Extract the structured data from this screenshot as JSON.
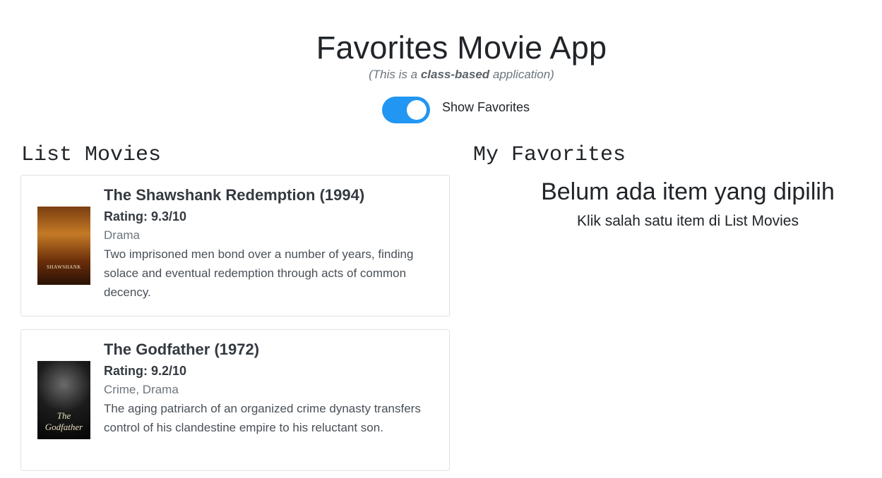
{
  "header": {
    "title": "Favorites Movie App",
    "subtitle_prefix": "(This is a ",
    "subtitle_bold": "class-based",
    "subtitle_suffix": " application)"
  },
  "toggle": {
    "label": "Show Favorites",
    "checked": true,
    "color": "#2196f3"
  },
  "list_section": {
    "heading": "List Movies",
    "movies": [
      {
        "title": "The Shawshank Redemption (1994)",
        "rating": "Rating: 9.3/10",
        "genre": "Drama",
        "description": "Two imprisoned men bond over a number of years, finding solace and eventual redemption through acts of common decency.",
        "poster_text": "SHAWSHANK"
      },
      {
        "title": "The Godfather (1972)",
        "rating": "Rating: 9.2/10",
        "genre": "Crime, Drama",
        "description": "The aging patriarch of an organized crime dynasty transfers control of his clandestine empire to his reluctant son.",
        "poster_text": "The Godfather"
      }
    ]
  },
  "favorites_section": {
    "heading": "My Favorites",
    "empty_title": "Belum ada item yang dipilih",
    "empty_subtitle": "Klik salah satu item di List Movies"
  }
}
